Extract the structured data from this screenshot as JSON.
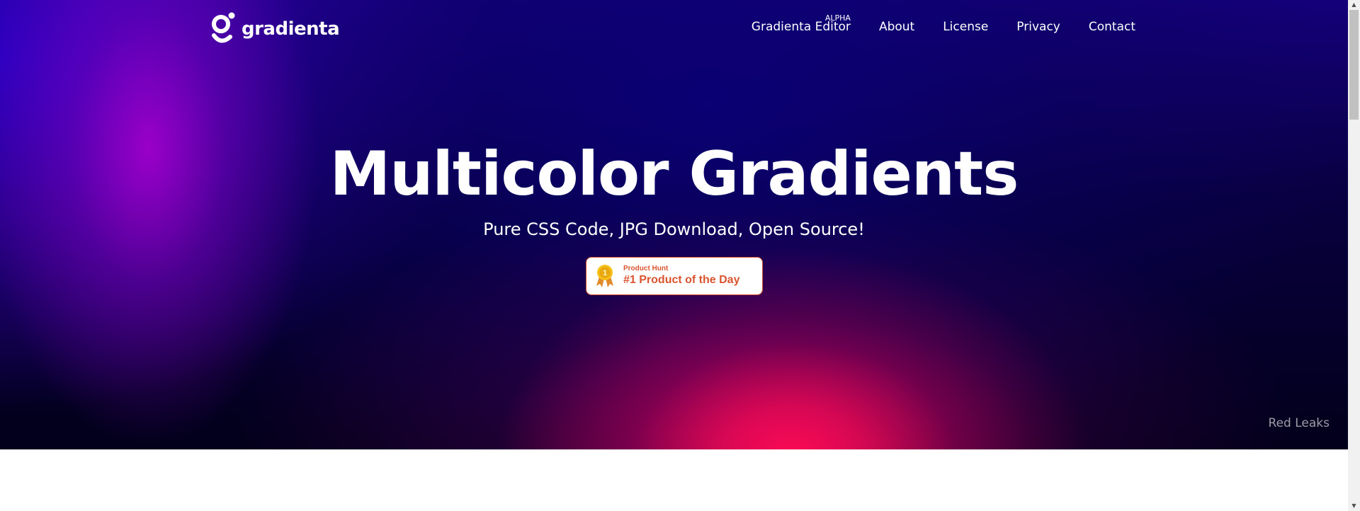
{
  "brand": {
    "name": "gradienta",
    "logo_icon": "gradienta-logo-icon"
  },
  "nav": {
    "items": [
      {
        "label": "Gradienta Editor",
        "badge": "ALPHA"
      },
      {
        "label": "About"
      },
      {
        "label": "License"
      },
      {
        "label": "Privacy"
      },
      {
        "label": "Contact"
      }
    ]
  },
  "hero": {
    "title": "Multicolor Gradients",
    "subtitle": "Pure CSS Code, JPG Download, Open Source!",
    "gradient_name": "Red Leaks"
  },
  "product_hunt": {
    "small": "Product Hunt",
    "big": "#1 Product of the Day",
    "rank": "1",
    "icon": "medal-icon",
    "color": "#da552f"
  },
  "colors": {
    "hero_top": "#14007a",
    "hero_bottom": "#02001a",
    "glow_pink": "#ff0a55",
    "glow_purple": "#af00d2"
  }
}
